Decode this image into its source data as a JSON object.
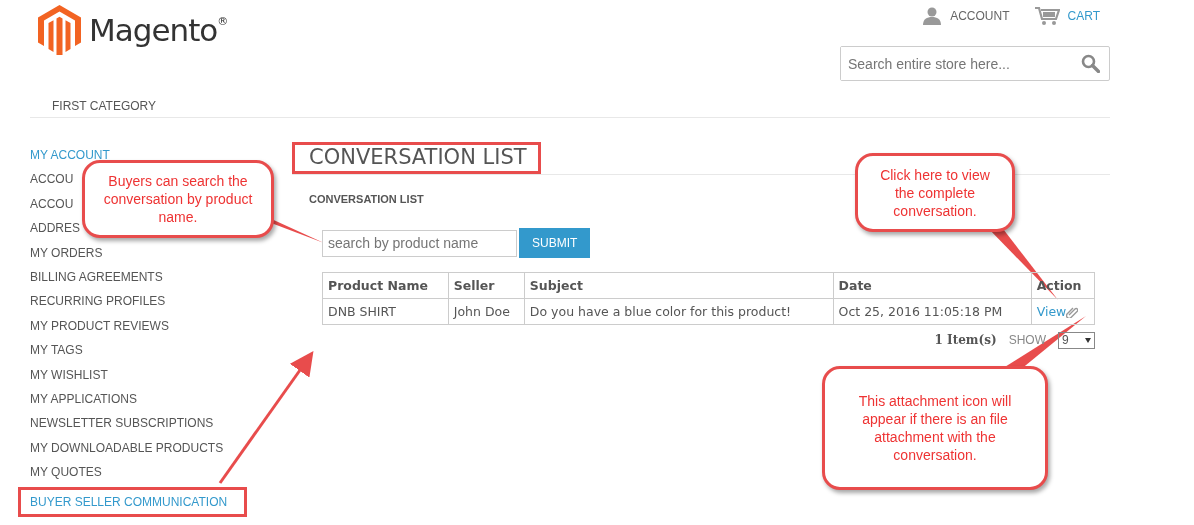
{
  "header": {
    "logo_text": "Magento$^{®}$",
    "top_links": [
      {
        "kind": "account",
        "label": "ACCOUNT"
      },
      {
        "kind": "cart",
        "label": "CART"
      }
    ],
    "search": {
      "placeholder": "Search entire store here..."
    },
    "nav": [
      "FIRST CATEGORY"
    ]
  },
  "sidebar": {
    "title": "MY ACCOUNT",
    "items": [
      {
        "label": "ACCOU",
        "selected": false
      },
      {
        "label": "ACCOU",
        "selected": false
      },
      {
        "label": "ADDRES",
        "selected": false
      },
      {
        "label": "MY ORDERS",
        "selected": false
      },
      {
        "label": "BILLING AGREEMENTS",
        "selected": false
      },
      {
        "label": "RECURRING PROFILES",
        "selected": false
      },
      {
        "label": "MY PRODUCT REVIEWS",
        "selected": false
      },
      {
        "label": "MY TAGS",
        "selected": false
      },
      {
        "label": "MY WISHLIST",
        "selected": false
      },
      {
        "label": "MY APPLICATIONS",
        "selected": false
      },
      {
        "label": "NEWSLETTER SUBSCRIPTIONS",
        "selected": false
      },
      {
        "label": "MY DOWNLOADABLE PRODUCTS",
        "selected": false
      },
      {
        "label": "MY QUOTES",
        "selected": false
      },
      {
        "label": "BUYER SELLER COMMUNICATION",
        "selected": true
      }
    ]
  },
  "main": {
    "title": "CONVERSATION LIST",
    "subtitle": "CONVERSATION LIST",
    "search": {
      "placeholder": "search by product name",
      "button": "SUBMIT"
    },
    "table": {
      "columns": [
        "Product Name",
        "Seller",
        "Subject",
        "Date",
        "Action"
      ],
      "rows": [
        {
          "cells": [
            "DNB SHIRT",
            "John Doe",
            "Do you have a blue color for this product!",
            "Oct 25, 2016 11:05:18 PM"
          ],
          "action": "View",
          "attachment": true
        }
      ]
    },
    "pager": {
      "count": "1 Item(s)",
      "show_label": "SHOW",
      "per_page": "9"
    }
  },
  "callouts": [
    "Buyers can search the conversation by product name.",
    "Click here to view the complete conversation.",
    "This attachment icon will appear if there is an file attachment with the conversation."
  ]
}
